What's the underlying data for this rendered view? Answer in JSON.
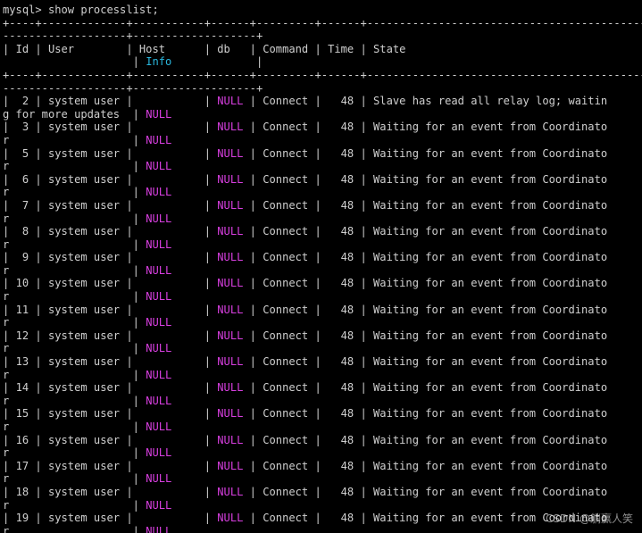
{
  "terminal": {
    "prompt": "mysql> ",
    "command": "show processlist;",
    "colors": {
      "background": "#000000",
      "text": "#cfcfcf",
      "info_header": "#2ab7dd",
      "null_value": "#d83fe0"
    },
    "border_top": "+----+-------------+-----------+------+---------+------+------------------------------------------------------------------------",
    "border_top_wrap": "-------------------+-------------------+",
    "header": {
      "id": "Id",
      "user": "User",
      "host": "Host",
      "db": "db",
      "command": "Command",
      "time": "Time",
      "state": "State",
      "info": "Info"
    },
    "rows": [
      {
        "id": "2",
        "user": "system user",
        "db": "NULL",
        "command": "Connect",
        "time": "48",
        "state_line1": "Slave has read all relay log; waitin",
        "state_line2": "g for more updates",
        "info": "NULL"
      },
      {
        "id": "3",
        "user": "system user",
        "db": "NULL",
        "command": "Connect",
        "time": "48",
        "state_line1": "Waiting for an event from Coordinato",
        "state_line2": "r",
        "info": "NULL"
      },
      {
        "id": "5",
        "user": "system user",
        "db": "NULL",
        "command": "Connect",
        "time": "48",
        "state_line1": "Waiting for an event from Coordinato",
        "state_line2": "r",
        "info": "NULL"
      },
      {
        "id": "6",
        "user": "system user",
        "db": "NULL",
        "command": "Connect",
        "time": "48",
        "state_line1": "Waiting for an event from Coordinato",
        "state_line2": "r",
        "info": "NULL"
      },
      {
        "id": "7",
        "user": "system user",
        "db": "NULL",
        "command": "Connect",
        "time": "48",
        "state_line1": "Waiting for an event from Coordinato",
        "state_line2": "r",
        "info": "NULL"
      },
      {
        "id": "8",
        "user": "system user",
        "db": "NULL",
        "command": "Connect",
        "time": "48",
        "state_line1": "Waiting for an event from Coordinato",
        "state_line2": "r",
        "info": "NULL"
      },
      {
        "id": "9",
        "user": "system user",
        "db": "NULL",
        "command": "Connect",
        "time": "48",
        "state_line1": "Waiting for an event from Coordinato",
        "state_line2": "r",
        "info": "NULL"
      },
      {
        "id": "10",
        "user": "system user",
        "db": "NULL",
        "command": "Connect",
        "time": "48",
        "state_line1": "Waiting for an event from Coordinato",
        "state_line2": "r",
        "info": "NULL"
      },
      {
        "id": "11",
        "user": "system user",
        "db": "NULL",
        "command": "Connect",
        "time": "48",
        "state_line1": "Waiting for an event from Coordinato",
        "state_line2": "r",
        "info": "NULL"
      },
      {
        "id": "12",
        "user": "system user",
        "db": "NULL",
        "command": "Connect",
        "time": "48",
        "state_line1": "Waiting for an event from Coordinato",
        "state_line2": "r",
        "info": "NULL"
      },
      {
        "id": "13",
        "user": "system user",
        "db": "NULL",
        "command": "Connect",
        "time": "48",
        "state_line1": "Waiting for an event from Coordinato",
        "state_line2": "r",
        "info": "NULL"
      },
      {
        "id": "14",
        "user": "system user",
        "db": "NULL",
        "command": "Connect",
        "time": "48",
        "state_line1": "Waiting for an event from Coordinato",
        "state_line2": "r",
        "info": "NULL"
      },
      {
        "id": "15",
        "user": "system user",
        "db": "NULL",
        "command": "Connect",
        "time": "48",
        "state_line1": "Waiting for an event from Coordinato",
        "state_line2": "r",
        "info": "NULL"
      },
      {
        "id": "16",
        "user": "system user",
        "db": "NULL",
        "command": "Connect",
        "time": "48",
        "state_line1": "Waiting for an event from Coordinato",
        "state_line2": "r",
        "info": "NULL"
      },
      {
        "id": "17",
        "user": "system user",
        "db": "NULL",
        "command": "Connect",
        "time": "48",
        "state_line1": "Waiting for an event from Coordinato",
        "state_line2": "r",
        "info": "NULL"
      },
      {
        "id": "18",
        "user": "system user",
        "db": "NULL",
        "command": "Connect",
        "time": "48",
        "state_line1": "Waiting for an event from Coordinato",
        "state_line2": "r",
        "info": "NULL"
      },
      {
        "id": "19",
        "user": "system user",
        "db": "NULL",
        "command": "Connect",
        "time": "48",
        "state_line1": "Waiting for an event from Coordinato",
        "state_line2": "r",
        "info": "NULL"
      }
    ],
    "watermark": "CSDN @躺赢人笑"
  }
}
